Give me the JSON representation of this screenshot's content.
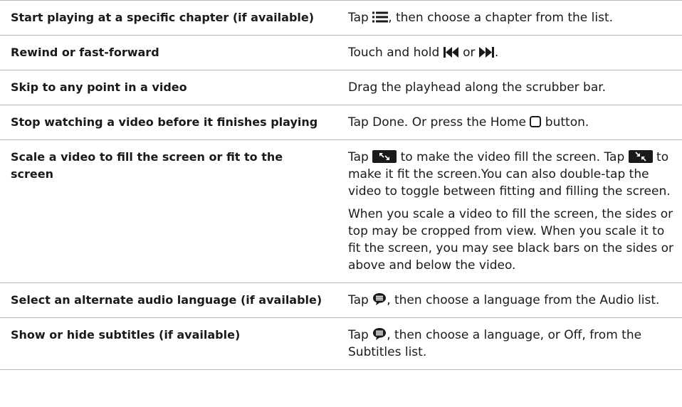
{
  "rows": [
    {
      "action": "Start playing at a specific chapter (if available)",
      "how": [
        "Tap [chapters-icon], then choose a chapter from the list."
      ]
    },
    {
      "action": "Rewind or fast-forward",
      "how": [
        "Touch and hold [rewind-icon] or [fast-forward-icon]."
      ]
    },
    {
      "action": "Skip to any point in a video",
      "how": [
        "Drag the playhead along the scrubber bar."
      ]
    },
    {
      "action": "Stop watching a video before it finishes playing",
      "how": [
        "Tap Done. Or press the Home [home-icon] button."
      ]
    },
    {
      "action": "Scale a video to fill the screen or fit to the screen",
      "how": [
        "Tap [fill-screen-icon] to make the video fill the screen. Tap [fit-screen-icon] to make it fit the screen.You can also double-tap the video to toggle between fitting and filling the screen.",
        "When you scale a video to fill the screen, the sides or top may be cropped from view. When you scale it to fit the screen, you may see black bars on the sides or above and below the video."
      ]
    },
    {
      "action": "Select an alternate audio language (if available)",
      "how": [
        "Tap [speech-bubble-icon], then choose a language from the Audio list."
      ]
    },
    {
      "action": "Show or hide subtitles (if available)",
      "how": [
        "Tap [speech-bubble-icon], then choose a language, or Off, from the Subtitles list."
      ]
    }
  ],
  "icons": {
    "chapters-icon": "chapters-icon",
    "rewind-icon": "rewind-icon",
    "fast-forward-icon": "fast-forward-icon",
    "home-icon": "home-icon",
    "fill-screen-icon": "fill-screen-icon",
    "fit-screen-icon": "fit-screen-icon",
    "speech-bubble-icon": "speech-bubble-icon"
  }
}
